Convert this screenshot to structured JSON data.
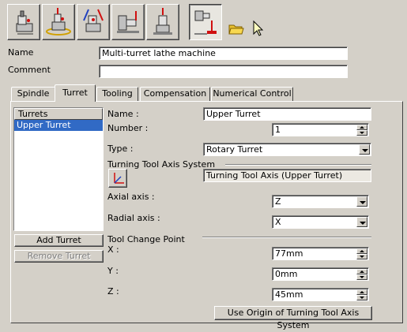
{
  "toolbar": {
    "buttons": [
      {
        "name": "spindle-machine-icon"
      },
      {
        "name": "rotary-table-machine-icon"
      },
      {
        "name": "multi-axis-machine-icon"
      },
      {
        "name": "lathe-machine-icon"
      },
      {
        "name": "vertical-machine-icon"
      },
      {
        "name": "multi-turret-lathe-icon",
        "pressed": true
      }
    ],
    "small_buttons": [
      {
        "name": "open-folder-icon"
      },
      {
        "name": "select-arrow-icon"
      }
    ]
  },
  "form": {
    "name_label": "Name",
    "name_value": "Multi-turret lathe machine",
    "comment_label": "Comment",
    "comment_value": ""
  },
  "tabs": [
    {
      "label": "Spindle",
      "active": false
    },
    {
      "label": "Turret",
      "active": true
    },
    {
      "label": "Tooling",
      "active": false
    },
    {
      "label": "Compensation",
      "active": false
    },
    {
      "label": "Numerical Control",
      "active": false
    }
  ],
  "turrets": {
    "header": "Turrets",
    "items": [
      "Upper Turret"
    ],
    "selected_index": 0,
    "add_label": "Add Turret",
    "remove_label": "Remove Turret"
  },
  "turret_details": {
    "name_label": "Name :",
    "name_value": "Upper Turret",
    "number_label": "Number :",
    "number_value": "1",
    "type_label": "Type :",
    "type_value": "Rotary Turret",
    "axis_system_title": "Turning Tool Axis System",
    "axis_system_value": "Turning Tool Axis (Upper Turret)",
    "axial_label": "Axial axis :",
    "axial_value": "Z",
    "radial_label": "Radial axis :",
    "radial_value": "X",
    "tool_change_title": "Tool Change Point",
    "x_label": "X :",
    "x_value": "77mm",
    "y_label": "Y :",
    "y_value": "0mm",
    "z_label": "Z :",
    "z_value": "45mm",
    "use_origin_label": "Use Origin of Turning Tool Axis System"
  },
  "colors": {
    "background": "#d4d0c8",
    "selection": "#316ac5",
    "icon_red": "#d01010",
    "icon_blue": "#2040c0"
  }
}
